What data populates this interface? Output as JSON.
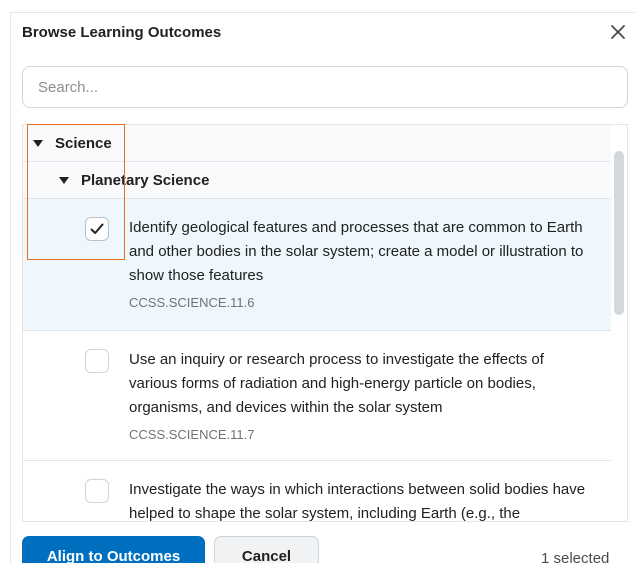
{
  "dialog": {
    "title": "Browse Learning Outcomes"
  },
  "icons": {
    "close": "close-icon",
    "caret": "caret-down-icon",
    "check": "checkmark-icon"
  },
  "search": {
    "placeholder": "Search..."
  },
  "tree": {
    "nodes": [
      {
        "label": "Science",
        "expanded": true
      },
      {
        "label": "Planetary Science",
        "expanded": true
      }
    ],
    "outcomes": [
      {
        "text": "Identify geological features and processes that are common to Earth and other bodies in the solar system; create a model or illustration to show those features",
        "code": "CCSS.SCIENCE.11.6",
        "checked": true
      },
      {
        "text": "Use an inquiry or research process to investigate the effects of various forms of radiation and high-energy particle on bodies, organisms, and devices within the solar system",
        "code": "CCSS.SCIENCE.11.7",
        "checked": false
      },
      {
        "text": "Investigate the ways in which interactions between solid bodies have helped to shape the solar system, including Earth (e.g., the",
        "checked": false
      }
    ]
  },
  "footer": {
    "primary_label": "Align to Outcomes",
    "secondary_label": "Cancel",
    "selected_text": "1 selected"
  },
  "colors": {
    "primary": "#006fbf",
    "selected_row": "#eef7fc",
    "highlight": "#ea6a1e"
  }
}
